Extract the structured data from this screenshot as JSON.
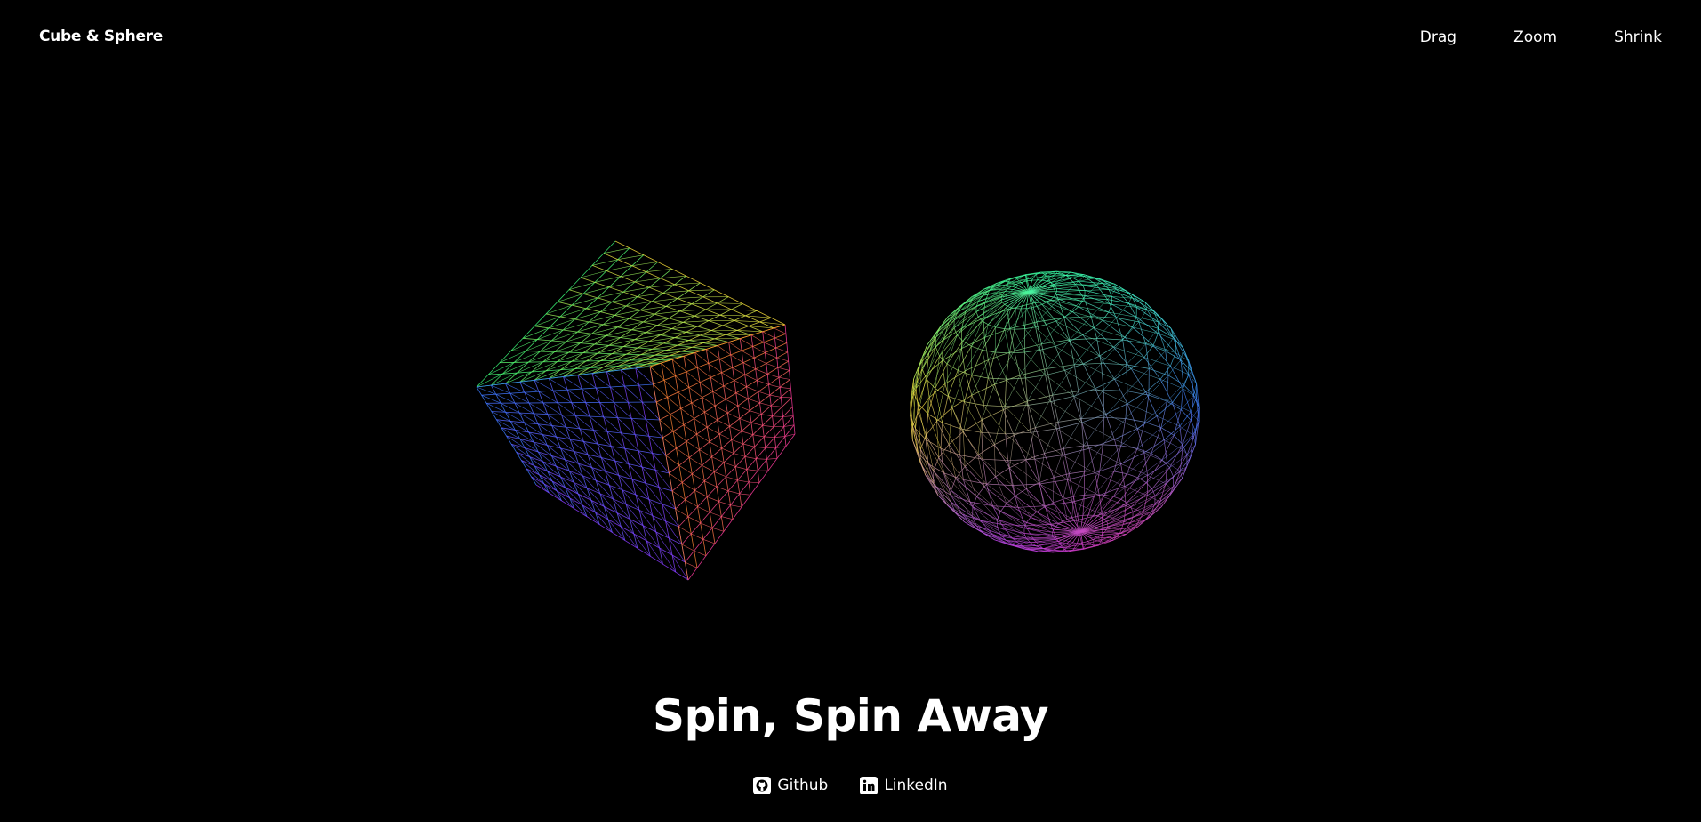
{
  "header": {
    "brand": "Cube & Sphere",
    "nav": [
      {
        "label": "Drag"
      },
      {
        "label": "Zoom"
      },
      {
        "label": "Shrink"
      }
    ]
  },
  "hero": {
    "title": "Spin, Spin Away"
  },
  "links": [
    {
      "label": "Github",
      "icon": "github-icon"
    },
    {
      "label": "LinkedIn",
      "icon": "linkedin-icon"
    }
  ],
  "colors": {
    "background": "#000000",
    "text": "#ffffff",
    "wire_palette": [
      "#39ff7a",
      "#b8ff3a",
      "#ffe23a",
      "#ff3aa0",
      "#8a3aff",
      "#3a7aff",
      "#3affd8",
      "#ff8a2a"
    ]
  }
}
